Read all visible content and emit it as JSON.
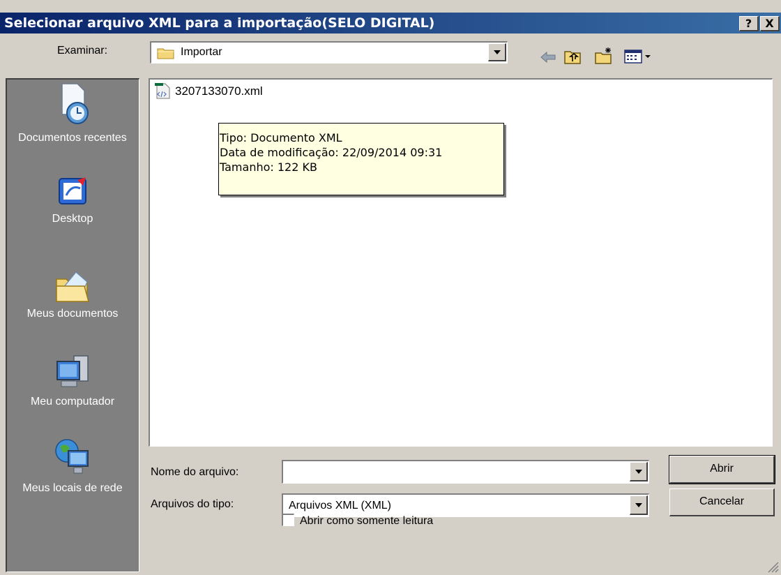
{
  "window": {
    "title": "Selecionar arquivo XML para a importação(SELO DIGITAL)",
    "help_btn": "?",
    "close_btn": "X"
  },
  "lookin": {
    "label": "Examinar:",
    "value": "Importar"
  },
  "places": [
    {
      "label": "Documentos recentes",
      "icon": "recent-documents-icon"
    },
    {
      "label": "Desktop",
      "icon": "desktop-icon"
    },
    {
      "label": "Meus documentos",
      "icon": "my-documents-icon"
    },
    {
      "label": "Meu computador",
      "icon": "my-computer-icon"
    },
    {
      "label": "Meus locais de rede",
      "icon": "network-places-icon"
    }
  ],
  "files": [
    {
      "name": "3207133070.xml",
      "icon": "xml-file-icon"
    }
  ],
  "tooltip": {
    "type": "Tipo: Documento XML",
    "modified": "Data de modificação: 22/09/2014 09:31",
    "size": "Tamanho: 122 KB"
  },
  "filename": {
    "label": "Nome do arquivo:",
    "value": ""
  },
  "filetype": {
    "label": "Arquivos do tipo:",
    "value": "Arquivos XML (XML)"
  },
  "buttons": {
    "open": "Abrir",
    "cancel": "Cancelar"
  },
  "readonly": {
    "label": "Abrir como somente leitura",
    "checked": false
  },
  "colors": {
    "title_start": "#0a246a",
    "title_end": "#3a6ea5",
    "face": "#d4d0c8",
    "places_bg": "#808080",
    "tooltip_bg": "#ffffe1"
  }
}
